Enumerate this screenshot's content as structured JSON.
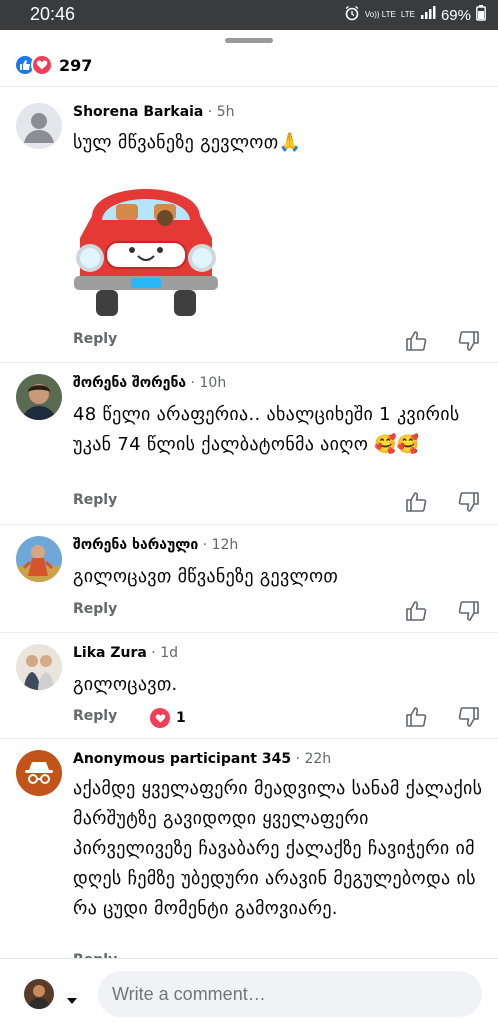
{
  "status_bar": {
    "time": "20:46",
    "network_top": "Vo)) LTE",
    "network_bottom": "LTE",
    "battery": "69%",
    "icons": [
      "alarm-icon",
      "signal-icon",
      "battery-icon"
    ]
  },
  "reactions": {
    "icons": [
      "like-icon",
      "love-icon"
    ],
    "count": "297"
  },
  "comments": [
    {
      "name": "Shorena Barkaia",
      "time": "5h",
      "text": "სულ მწვანეზე გევლოთ🙏",
      "sticker": "red-car-sticker",
      "reply": "Reply"
    },
    {
      "name": "შორენა შორენა",
      "time": "10h",
      "text": "48 წელი არაფერია.. ახალციხეში 1 კვირის უკან 74 წლის ქალბატონმა აიღო 🥰🥰",
      "reply": "Reply"
    },
    {
      "name": "შორენა ხარაული",
      "time": "12h",
      "text": "გილოცავთ  მწვანეზე გევლოთ",
      "reply": "Reply"
    },
    {
      "name": "Lika Zura",
      "time": "1d",
      "text": "გილოცავთ.",
      "reply": "Reply",
      "reaction_count": "1"
    },
    {
      "name": "Anonymous participant 345",
      "time": "22h",
      "text": "აქამდე ყველაფერი მეადვილა სანამ ქალაქის მარშუტზე გავიდოდი ყველაფერი პირველივეზე ჩავაბარე ქალაქზე ჩავიჭერი იმ დღეს ჩემზე უბედური არავინ მეგულებოდა ის რა ცუდი მომენტი გამოვიარე.",
      "reply": "Reply"
    }
  ],
  "composer": {
    "placeholder": "Write a comment…"
  },
  "colors": {
    "accent": "#1877f2",
    "love": "#f33e58",
    "secondary_text": "#65676b"
  }
}
